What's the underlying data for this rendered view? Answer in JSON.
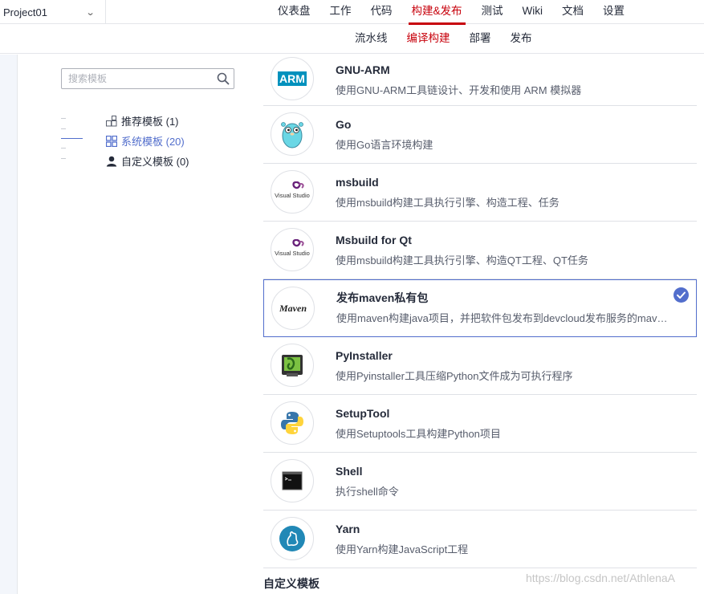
{
  "project": {
    "name": "Project01"
  },
  "main_nav": [
    {
      "label": "仪表盘"
    },
    {
      "label": "工作"
    },
    {
      "label": "代码"
    },
    {
      "label": "构建&发布"
    },
    {
      "label": "测试"
    },
    {
      "label": "Wiki"
    },
    {
      "label": "文档"
    },
    {
      "label": "设置"
    }
  ],
  "sub_nav": [
    {
      "label": "流水线"
    },
    {
      "label": "编译构建"
    },
    {
      "label": "部署"
    },
    {
      "label": "发布"
    }
  ],
  "search": {
    "placeholder": "搜索模板"
  },
  "categories": [
    {
      "label": "推荐模板 (1)"
    },
    {
      "label": "系统模板 (20)"
    },
    {
      "label": "自定义模板 (0)"
    }
  ],
  "templates": [
    {
      "name": "GNU-ARM",
      "desc": "使用GNU-ARM工具链设计、开发和使用 ARM 模拟器",
      "logo_text": "ARM"
    },
    {
      "name": "Go",
      "desc": "使用Go语言环境构建"
    },
    {
      "name": "msbuild",
      "desc": "使用msbuild构建工具执行引擎、构造工程、任务",
      "logo_text": "Visual Studio"
    },
    {
      "name": "Msbuild for Qt",
      "desc": "使用msbuild构建工具执行引擎、构造QT工程、QT任务",
      "logo_text": "Visual Studio"
    },
    {
      "name": "发布maven私有包",
      "desc": "使用maven构建java项目，并把软件包发布到devcloud发布服务的maven私有依赖库",
      "logo_text": "Maven"
    },
    {
      "name": "PyInstaller",
      "desc": "使用Pyinstaller工具压缩Python文件成为可执行程序"
    },
    {
      "name": "SetupTool",
      "desc": "使用Setuptools工具构建Python项目"
    },
    {
      "name": "Shell",
      "desc": "执行shell命令"
    },
    {
      "name": "Yarn",
      "desc": "使用Yarn构建JavaScript工程"
    }
  ],
  "custom_section": {
    "title": "自定义模板"
  },
  "watermark": "https://blog.csdn.net/AthlenaA",
  "colors": {
    "accent_red": "#c7000b",
    "accent_blue": "#526ecc"
  }
}
